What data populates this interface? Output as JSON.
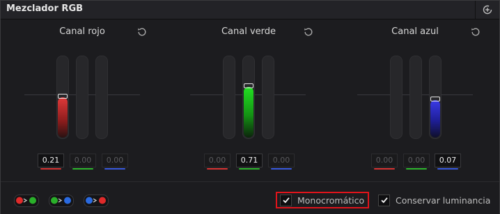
{
  "window": {
    "title": "Mezclador RGB"
  },
  "channels": [
    {
      "title": "Canal rojo",
      "values": [
        "0.21",
        "0.00",
        "0.00"
      ],
      "levels": [
        0.21,
        0.0,
        0.0
      ],
      "active_index": 0,
      "color": "#e03a3a"
    },
    {
      "title": "Canal verde",
      "values": [
        "0.00",
        "0.71",
        "0.00"
      ],
      "levels": [
        0.0,
        0.71,
        0.0
      ],
      "active_index": 1,
      "color": "#22d422"
    },
    {
      "title": "Canal azul",
      "values": [
        "0.00",
        "0.00",
        "0.07"
      ],
      "levels": [
        0.0,
        0.0,
        0.07
      ],
      "active_index": 2,
      "color": "#3a3ae8"
    }
  ],
  "underline_colors": [
    "#d83434",
    "#2fb82f",
    "#3a5ae0"
  ],
  "swap_buttons": [
    {
      "name": "swap-red-green",
      "from": "#e02a2a",
      "to": "#2ab02a"
    },
    {
      "name": "swap-green-blue",
      "from": "#2ab02a",
      "to": "#2a6ae0"
    },
    {
      "name": "swap-blue-red",
      "from": "#2a6ae0",
      "to": "#e02a2a"
    }
  ],
  "options": {
    "monochrome_label": "Monocromático",
    "monochrome_checked": true,
    "preserve_luminance_label": "Conservar luminancia",
    "preserve_luminance_checked": true
  },
  "icons": {
    "window_button": "reset-all-icon",
    "channel_reset": "reset-icon",
    "checkbox": "checkmark-icon"
  }
}
